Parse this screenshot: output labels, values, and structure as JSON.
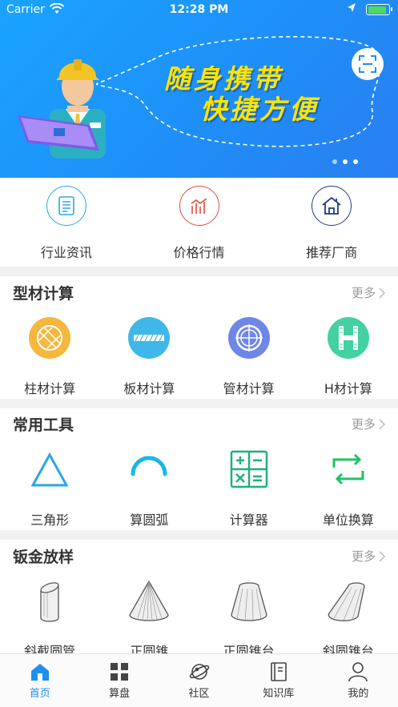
{
  "status_bar": {
    "carrier": "Carrier",
    "time": "12:28 PM"
  },
  "banner": {
    "line1": "随身携带",
    "line2": "快捷方便",
    "slide_count": 3,
    "active_slide": 1
  },
  "quick_links": [
    {
      "label": "行业资讯",
      "icon": "news-icon",
      "color": "#2aa6e6"
    },
    {
      "label": "价格行情",
      "icon": "price-chart-icon",
      "color": "#e04a3a"
    },
    {
      "label": "推荐厂商",
      "icon": "house-icon",
      "color": "#1f3b8a"
    }
  ],
  "sections": {
    "profile_calc": {
      "title": "型材计算",
      "more": "更多",
      "items": [
        {
          "label": "柱材计算",
          "icon": "column-material-icon"
        },
        {
          "label": "板材计算",
          "icon": "plate-material-icon"
        },
        {
          "label": "管材计算",
          "icon": "pipe-material-icon"
        },
        {
          "label": "H材计算",
          "icon": "h-beam-icon"
        }
      ]
    },
    "tools": {
      "title": "常用工具",
      "more": "更多",
      "items": [
        {
          "label": "三角形",
          "icon": "triangle-icon"
        },
        {
          "label": "算圆弧",
          "icon": "arc-icon"
        },
        {
          "label": "计算器",
          "icon": "calculator-icon"
        },
        {
          "label": "单位换算",
          "icon": "unit-convert-icon"
        }
      ]
    },
    "sheet_metal": {
      "title": "钣金放样",
      "more": "更多",
      "items": [
        {
          "label": "斜截圆管",
          "icon": "oblique-pipe-icon"
        },
        {
          "label": "正圆锥",
          "icon": "cone-icon"
        },
        {
          "label": "正圆锥台",
          "icon": "frustum-icon"
        },
        {
          "label": "斜圆锥台",
          "icon": "oblique-frustum-icon"
        }
      ]
    }
  },
  "tabbar": [
    {
      "label": "首页",
      "icon": "home-icon",
      "active": true
    },
    {
      "label": "算盘",
      "icon": "grid-icon",
      "active": false
    },
    {
      "label": "社区",
      "icon": "planet-icon",
      "active": false
    },
    {
      "label": "知识库",
      "icon": "book-icon",
      "active": false
    },
    {
      "label": "我的",
      "icon": "user-icon",
      "active": false
    }
  ],
  "colors": {
    "accent": "#1e90f0",
    "banner": "#1aa3ff",
    "slogan": "#ffe400"
  }
}
